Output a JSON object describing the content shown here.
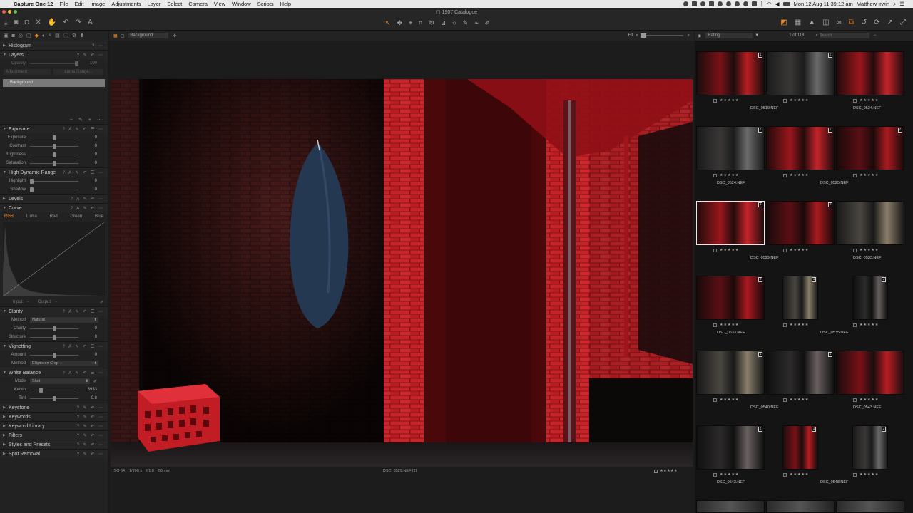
{
  "menubar": {
    "app": "Capture One 12",
    "items": [
      "File",
      "Edit",
      "Image",
      "Adjustments",
      "Layer",
      "Select",
      "Camera",
      "View",
      "Window",
      "Scripts",
      "Help"
    ],
    "datetime": "Mon 12 Aug  11:39:12 am",
    "user": "Matthew Irwin"
  },
  "window": {
    "title": "1907 Catalogue"
  },
  "left_panel": {
    "histogram": "Histogram",
    "layers": {
      "title": "Layers",
      "opacity_label": "Opacity",
      "opacity_value": "100",
      "adjustment_btn": "Adjustment",
      "luma_btn": "Luma Range...",
      "background_layer": "Background"
    },
    "exposure": {
      "title": "Exposure",
      "rows": [
        {
          "label": "Exposure",
          "value": "0",
          "pos": 0.5
        },
        {
          "label": "Contrast",
          "value": "0",
          "pos": 0.5
        },
        {
          "label": "Brightness",
          "value": "0",
          "pos": 0.5
        },
        {
          "label": "Saturation",
          "value": "0",
          "pos": 0.5
        }
      ]
    },
    "hdr": {
      "title": "High Dynamic Range",
      "rows": [
        {
          "label": "Highlight",
          "value": "0",
          "pos": 0.0
        },
        {
          "label": "Shadow",
          "value": "0",
          "pos": 0.0
        }
      ]
    },
    "levels": "Levels",
    "curve": {
      "title": "Curve",
      "tabs": [
        "RGB",
        "Luma",
        "Red",
        "Green",
        "Blue"
      ],
      "input": "Input:",
      "input_val": "-",
      "output": "Output:",
      "output_val": "-"
    },
    "clarity": {
      "title": "Clarity",
      "method_label": "Method",
      "method": "Natural",
      "rows": [
        {
          "label": "Clarity",
          "value": "0",
          "pos": 0.5
        },
        {
          "label": "Structure",
          "value": "0",
          "pos": 0.5
        }
      ]
    },
    "vignetting": {
      "title": "Vignetting",
      "amount_label": "Amount",
      "amount": "0",
      "method_label": "Method",
      "method": "Elliptic on Crop"
    },
    "white_balance": {
      "title": "White Balance",
      "mode_label": "Mode",
      "mode": "Shot",
      "rows": [
        {
          "label": "Kelvin",
          "value": "3933",
          "pos": 0.2
        },
        {
          "label": "Tint",
          "value": "0.8",
          "pos": 0.5
        }
      ]
    },
    "bottom_sections": [
      "Keystone",
      "Keywords",
      "Keyword Library",
      "Filters",
      "Styles and Presets",
      "Spot Removal"
    ]
  },
  "viewer": {
    "layer_select": "Background",
    "fit_label": "Fit",
    "exif": [
      "ISO 64",
      "1/200 s",
      "f/1.8",
      "50 mm"
    ],
    "filename": "DSC_0529.NEF [1]"
  },
  "browser": {
    "sort": "Rating",
    "count": "1 of 118",
    "search_placeholder": "Search",
    "rows": [
      {
        "name": "DSC_0510.NEF",
        "name2": "DSC_0524.NEF",
        "badges": [
          "1",
          "2",
          ""
        ]
      },
      {
        "name": "DSC_0524.NEF",
        "name2": "DSC_0525.NEF",
        "badges": [
          "2",
          "1",
          "2"
        ]
      },
      {
        "name": "DSC_0529.NEF",
        "name2": "DSC_0533.NEF",
        "badges": [
          "1",
          "2",
          ""
        ]
      },
      {
        "name": "DSC_0533.NEF",
        "name2": "DSC_0535.NEF",
        "badges": [
          "2",
          "1",
          "2"
        ]
      },
      {
        "name": "DSC_0540.NEF",
        "name2": "DSC_0543.NEF",
        "badges": [
          "1",
          "2",
          ""
        ]
      },
      {
        "name": "DSC_0543.NEF",
        "name2": "DSC_0548.NEF",
        "badges": [
          "2",
          "1",
          "2"
        ]
      }
    ],
    "stars": "★★★★★"
  },
  "colors": {
    "accent": "#f08a24",
    "brick": "#b81d22"
  }
}
